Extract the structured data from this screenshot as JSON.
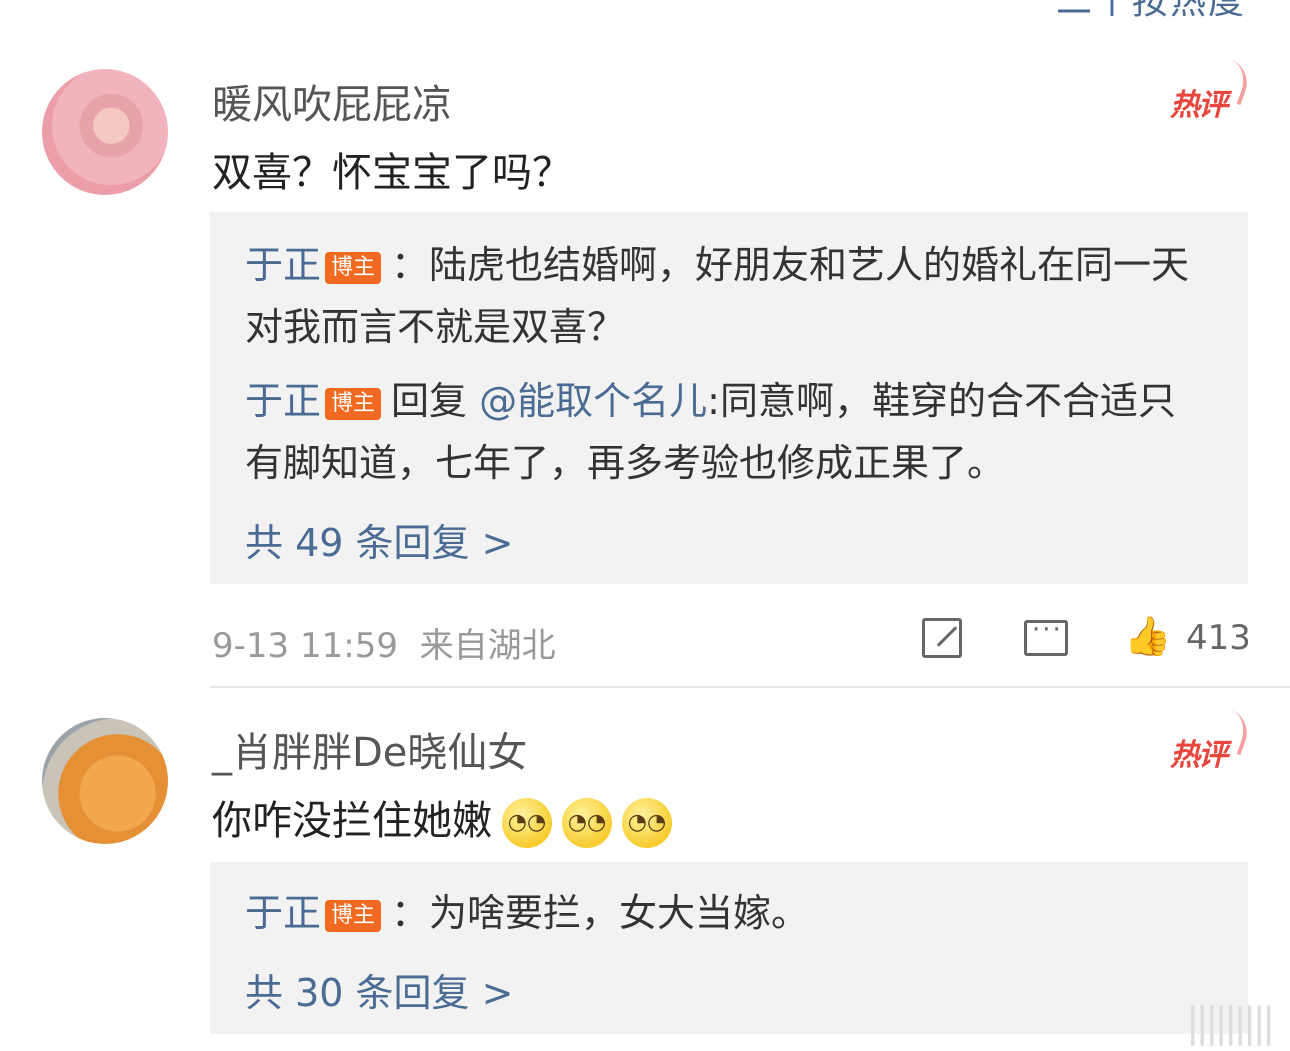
{
  "header_fragment": "二个按热度",
  "comments": [
    {
      "username": "暖风吹屁屁凉",
      "hot_badge": "热评",
      "content": "双喜？怀宝宝了吗？",
      "replies": [
        {
          "name": "于正",
          "badge": "博主",
          "text": "：陆虎也结婚啊，好朋友和艺人的婚礼在同一天对我而言不就是双喜？"
        },
        {
          "name": "于正",
          "badge": "博主",
          "prefix": "回复",
          "mention": "@能取个名儿",
          "text": ":同意啊，鞋穿的合不合适只有脚知道，七年了，再多考验也修成正果了。"
        }
      ],
      "more_replies": "共 49 条回复 >",
      "timestamp": "9-13 11:59",
      "location": "来自湖北",
      "like_count": "413"
    },
    {
      "username": "_肖胖胖De晓仙女",
      "hot_badge": "热评",
      "content": "你咋没拦住她嫩",
      "emoji_count": 3,
      "replies": [
        {
          "name": "于正",
          "badge": "博主",
          "text": "：为啥要拦，女大当嫁。"
        }
      ],
      "more_replies": "共 30 条回复 >"
    }
  ],
  "icons": {
    "share": "share-icon",
    "comment": "comment-icon",
    "like": "thumbs-up-icon",
    "emoji": "covering-eyes-emoji"
  },
  "colors": {
    "link_blue": "#4a6b93",
    "hot_red": "#e8463c",
    "badge_orange": "#f26a21",
    "reply_bg": "#f2f2f2"
  }
}
